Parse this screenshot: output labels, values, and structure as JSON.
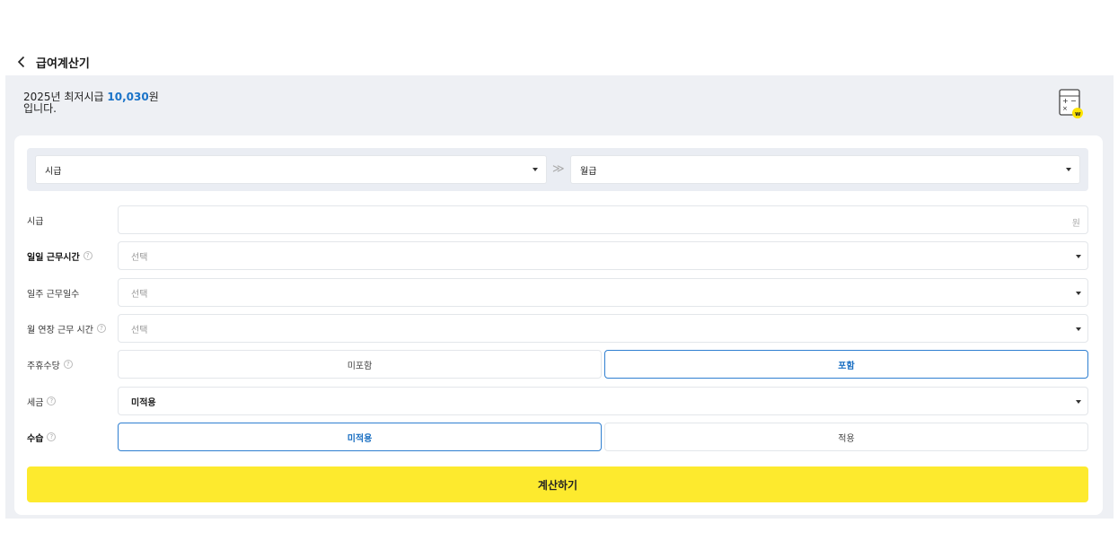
{
  "header": {
    "title": "급여계산기"
  },
  "banner": {
    "line1_prefix": "2025년 최저시급 ",
    "wage": "10,030",
    "line1_suffix": "원",
    "line2": "입니다."
  },
  "converter": {
    "from": "시급",
    "to": "월급",
    "arrow": "≫"
  },
  "form": {
    "hourly": {
      "label": "시급",
      "placeholder": "",
      "unit": "원"
    },
    "daily_hours": {
      "label": "일일 근무시간",
      "value": "선택"
    },
    "weekly_days": {
      "label": "일주 근무일수",
      "value": "선택"
    },
    "overtime": {
      "label": "월 연장 근무 시간",
      "value": "선택"
    },
    "holiday_pay": {
      "label": "주휴수당",
      "options": [
        "미포함",
        "포함"
      ],
      "selected": "포함"
    },
    "tax": {
      "label": "세금",
      "value": "미적용"
    },
    "probation": {
      "label": "수습",
      "options": [
        "미적용",
        "적용"
      ],
      "selected": "미적용"
    }
  },
  "help_glyph": "?",
  "submit_label": "계산하기",
  "colors": {
    "accent": "#1a73c8",
    "button": "#fdea2e",
    "panel": "#eef0f4"
  }
}
